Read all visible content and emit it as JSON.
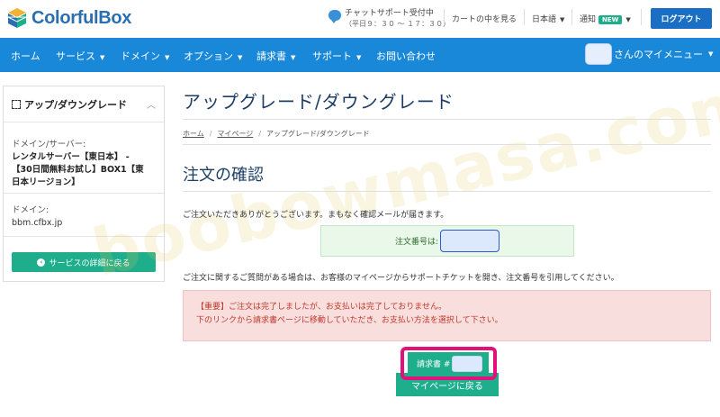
{
  "header": {
    "brand": "ColorfulBox",
    "support_title": "チャットサポート受付中",
    "support_hours": "（平日９：３０ ～ １７：３０）",
    "cart": "カートの中を見る",
    "language": "日本語",
    "notice": "通知",
    "notice_badge": "NEW",
    "logout": "ログアウト"
  },
  "nav": {
    "items": [
      {
        "label": "ホーム"
      },
      {
        "label": "サービス"
      },
      {
        "label": "ドメイン"
      },
      {
        "label": "オプション"
      },
      {
        "label": "請求書"
      },
      {
        "label": "サポート"
      },
      {
        "label": "お問い合わせ"
      }
    ],
    "my_menu": "さんのマイメニュー"
  },
  "sidebar": {
    "title": "アップ/ダウングレード",
    "server_label": "ドメイン/サーバー:",
    "server_value_1": "レンタルサーバー【東日本】 -",
    "server_value_2": "【30日間無料お試し】BOX1【東",
    "server_value_3": "日本リージョン】",
    "domain_label": "ドメイン:",
    "domain_value": "bbm.cfbx.jp",
    "back_button": "サービスの詳細に戻る"
  },
  "main": {
    "page_title": "アップグレード/ダウングレード",
    "breadcrumb": [
      "ホーム",
      "マイページ",
      "アップグレード/ダウングレード"
    ],
    "section_title": "注文の確認",
    "thanks": "ご注文いただきありがとうございます。まもなく確認メールが届きます。",
    "order_label": "注文番号は:",
    "inquiry": "ご注文に関するご質問がある場合は、お客様のマイページからサポートチケットを開き、注文番号を引用してください。",
    "alert_line_1": "【重要】ご注文は完了しましたが、お支払いは完了しておりません。",
    "alert_line_2": "下のリンクから請求書ページに移動していただき、お支払い方法を選択して下さい。",
    "invoice_button": "請求書 #",
    "mypage_button": "マイページに戻る"
  },
  "watermark": "boobowmasa.com",
  "colors": {
    "primary": "#1a88d9",
    "accent": "#1fae8c",
    "highlight": "#e2107a",
    "title": "#1d3f66"
  },
  "icons": {
    "support": "chat-bubble-icon",
    "caret": "chevron-down-icon",
    "back": "arrow-left-circle-icon"
  }
}
